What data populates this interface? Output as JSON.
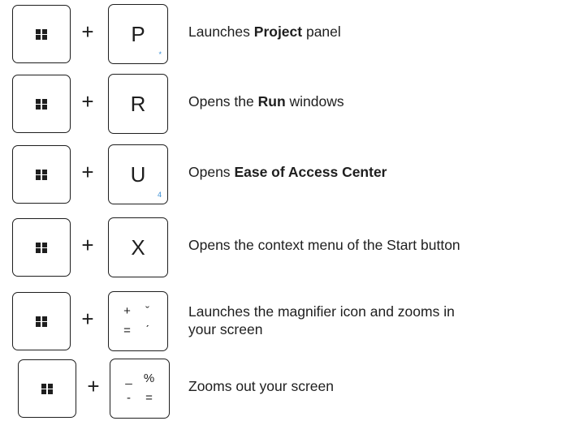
{
  "shortcuts": [
    {
      "key": "P",
      "sub": "*",
      "desc_pre": "Launches ",
      "desc_bold": "Project",
      "desc_post": " panel"
    },
    {
      "key": "R",
      "sub": "",
      "desc_pre": "Opens the ",
      "desc_bold": "Run",
      "desc_post": " windows"
    },
    {
      "key": "U",
      "sub": "4",
      "desc_pre": "Opens ",
      "desc_bold": "Ease of Access Center",
      "desc_post": ""
    },
    {
      "key": "X",
      "sub": "",
      "desc_pre": "Opens the context menu of the Start button",
      "desc_bold": "",
      "desc_post": ""
    },
    {
      "key_symbols": [
        "+",
        "ˇ",
        "=",
        "ˊ"
      ],
      "desc_line1": "Launches the magnifier icon and zooms in",
      "desc_line2": "your screen"
    },
    {
      "key_symbols": [
        "_",
        "%",
        "-",
        "="
      ],
      "desc_pre": "Zooms out your screen",
      "desc_bold": "",
      "desc_post": ""
    }
  ],
  "plus_sign": "+",
  "icons": {
    "windows_key": "windows-logo-icon"
  },
  "colors": {
    "text": "#1e1e1e",
    "key_border": "#1e1e1e",
    "subscript": "#3a8fd6"
  }
}
